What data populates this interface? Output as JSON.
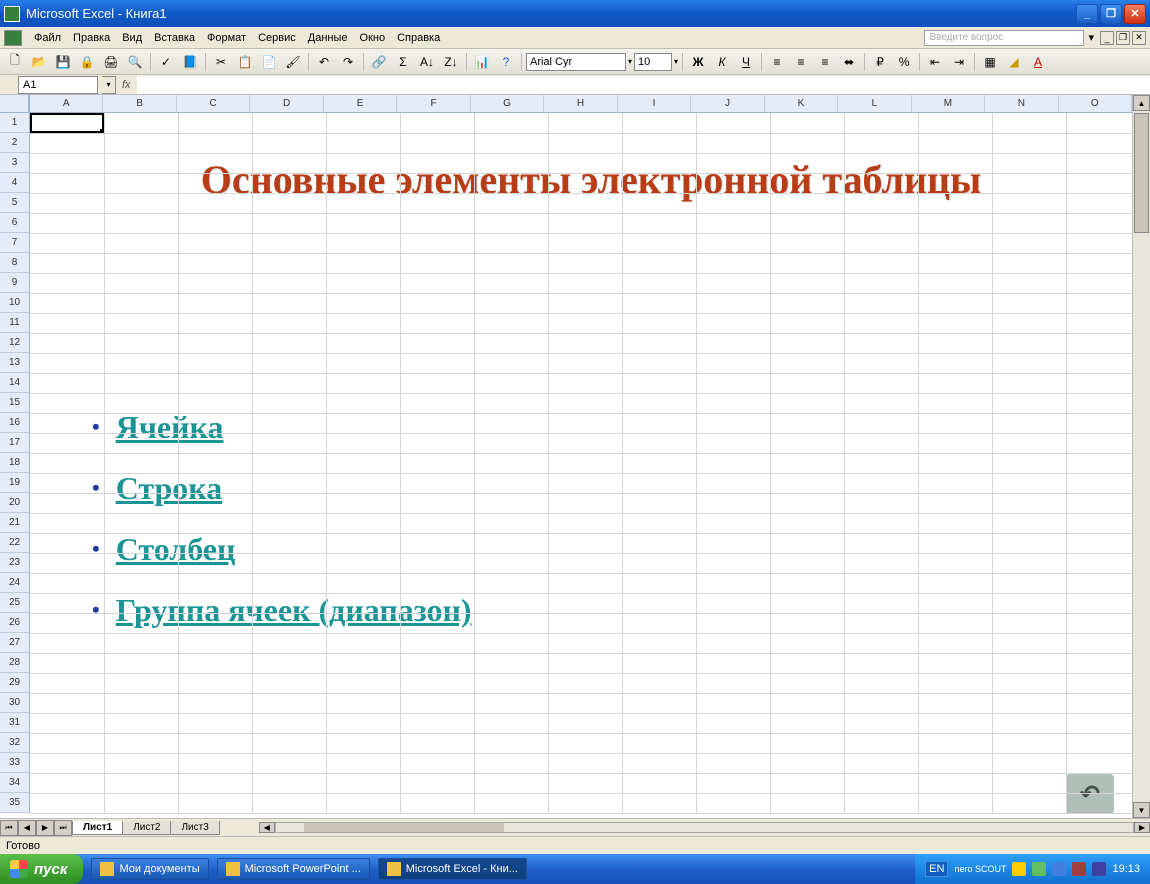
{
  "title": "Microsoft Excel - Книга1",
  "menu": {
    "file": "Файл",
    "edit": "Правка",
    "view": "Вид",
    "insert": "Вставка",
    "format": "Формат",
    "service": "Сервис",
    "data": "Данные",
    "window": "Окно",
    "help": "Справка",
    "help_placeholder": "Введите вопрос"
  },
  "toolbar": {
    "font": "Arial Cyr",
    "size": "10",
    "bold": "Ж",
    "italic": "К",
    "underline": "Ч"
  },
  "namebox": "A1",
  "columns": [
    "A",
    "B",
    "C",
    "D",
    "E",
    "F",
    "G",
    "H",
    "I",
    "J",
    "K",
    "L",
    "M",
    "N",
    "O"
  ],
  "row_count": 35,
  "content": {
    "heading": "Основные элементы электронной таблицы",
    "items": [
      "Ячейка",
      "Строка",
      "Столбец",
      "Группа ячеек (диапазон)"
    ]
  },
  "sheets": {
    "active": "Лист1",
    "others": [
      "Лист2",
      "Лист3"
    ]
  },
  "status": "Готово",
  "taskbar": {
    "start": "пуск",
    "tasks": [
      {
        "label": "Мои документы",
        "active": false
      },
      {
        "label": "Microsoft PowerPoint ...",
        "active": false
      },
      {
        "label": "Microsoft Excel - Кни...",
        "active": true
      }
    ],
    "lang": "EN",
    "nero": "nero SCOUT",
    "clock": "19:13"
  }
}
